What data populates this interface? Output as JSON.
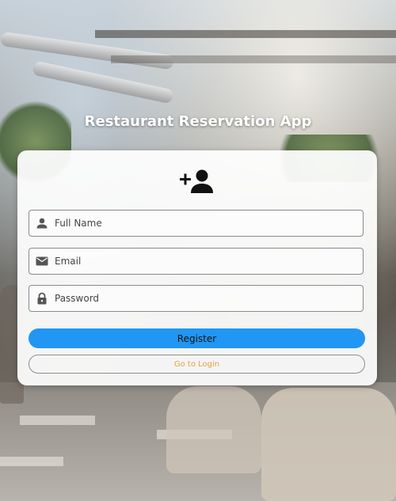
{
  "app": {
    "title": "Restaurant Reservation App"
  },
  "form": {
    "header_icon": "person-add-icon",
    "fields": [
      {
        "name": "full-name",
        "icon": "person-icon",
        "placeholder": "Full Name",
        "value": ""
      },
      {
        "name": "email",
        "icon": "email-icon",
        "placeholder": "Email",
        "value": ""
      },
      {
        "name": "password",
        "icon": "lock-icon",
        "placeholder": "Password",
        "value": ""
      }
    ],
    "register_label": "Register",
    "login_label": "Go to Login"
  },
  "colors": {
    "primary_button": "#2196f3",
    "link_text": "#e6a23c",
    "card_bg": "#ffffff",
    "title_text": "#ffffff"
  }
}
